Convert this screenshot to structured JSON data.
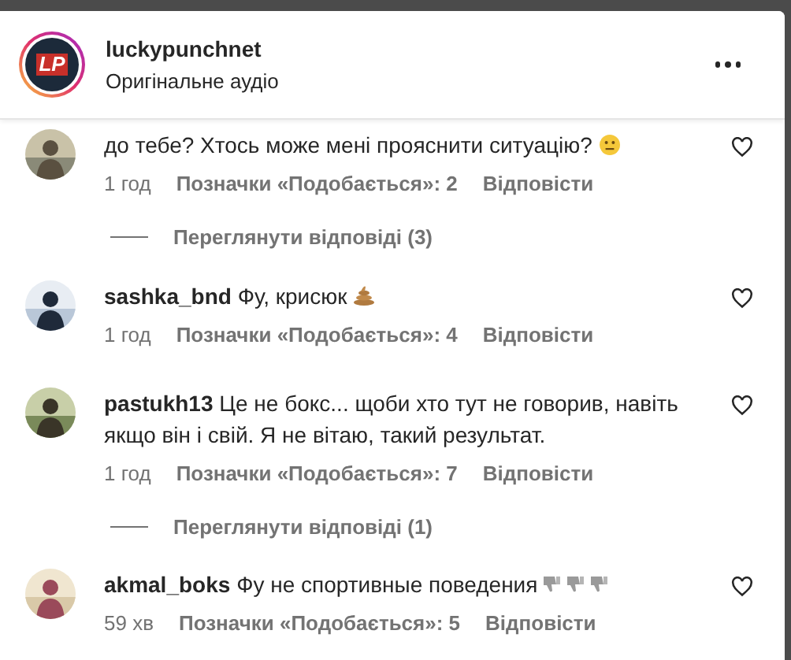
{
  "header": {
    "username": "luckypunchnet",
    "subtitle": "Оригінальне аудіо",
    "logo": "LP"
  },
  "comments": [
    {
      "text": "до тебе? Хтось може мені прояснити ситуацію?",
      "icons": [
        {
          "kind": "neutral-face"
        }
      ],
      "time": "1 год",
      "likes": "Позначки «Подобається»: 2",
      "reply": "Відповісти",
      "view_replies": "Переглянути відповіді (3)"
    },
    {
      "username": "sashka_bnd",
      "text": "Фу, крисюк",
      "icons": [
        {
          "kind": "poop"
        }
      ],
      "time": "1 год",
      "likes": "Позначки «Подобається»: 4",
      "reply": "Відповісти"
    },
    {
      "username": "pastukh13",
      "text": "Це не бокс... щоби хто тут не говорив, навіть якщо він і свій. Я не вітаю, такий результат.",
      "time": "1 год",
      "likes": "Позначки «Подобається»: 7",
      "reply": "Відповісти",
      "view_replies": "Переглянути відповіді (1)"
    },
    {
      "username": "akmal_boks",
      "text": "Фу не спортивные поведения",
      "icons": [
        {
          "kind": "thumbs-down"
        },
        {
          "kind": "thumbs-down"
        },
        {
          "kind": "thumbs-down"
        }
      ],
      "time": "59 хв",
      "likes": "Позначки «Подобається»: 5",
      "reply": "Відповісти"
    }
  ]
}
